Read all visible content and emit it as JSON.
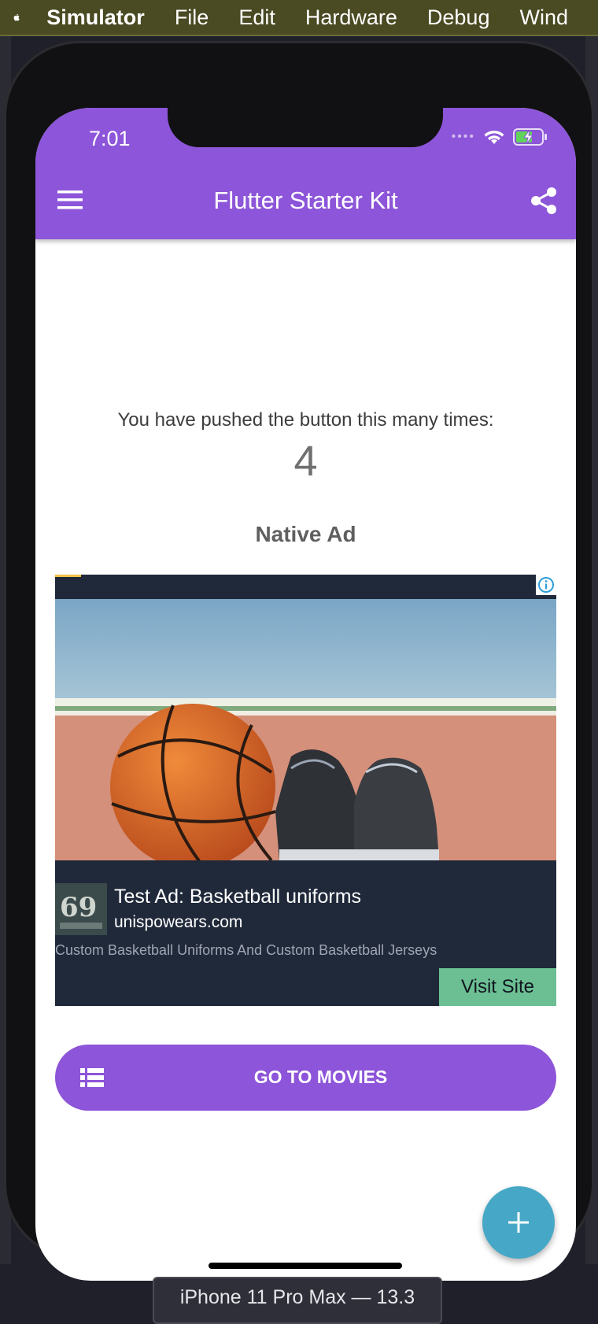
{
  "menubar": {
    "app_name": "Simulator",
    "items": [
      "File",
      "Edit",
      "Hardware",
      "Debug",
      "Wind"
    ]
  },
  "status_bar": {
    "time": "7:01",
    "battery": "charging"
  },
  "appbar": {
    "title": "Flutter Starter Kit",
    "leading_icon": "menu-icon",
    "trailing_icon": "share-icon",
    "color": "#8d55d9"
  },
  "counter": {
    "label": "You have pushed the button this many times:",
    "value": "4"
  },
  "native_ad": {
    "section_label": "Native Ad",
    "headline": "Test Ad: Basketball uniforms",
    "advertiser": "unispowears.com",
    "body": "Custom Basketball Uniforms And Custom Basketball Jerseys",
    "cta": "Visit Site",
    "logo_text": "69",
    "background": "#20293a",
    "cta_color": "#6cbf93"
  },
  "movies_button": {
    "label": "GO TO MOVIES",
    "icon": "list-icon"
  },
  "fab": {
    "icon": "plus-icon",
    "color": "#46a8c6"
  },
  "device_label": "iPhone 11 Pro Max — 13.3"
}
